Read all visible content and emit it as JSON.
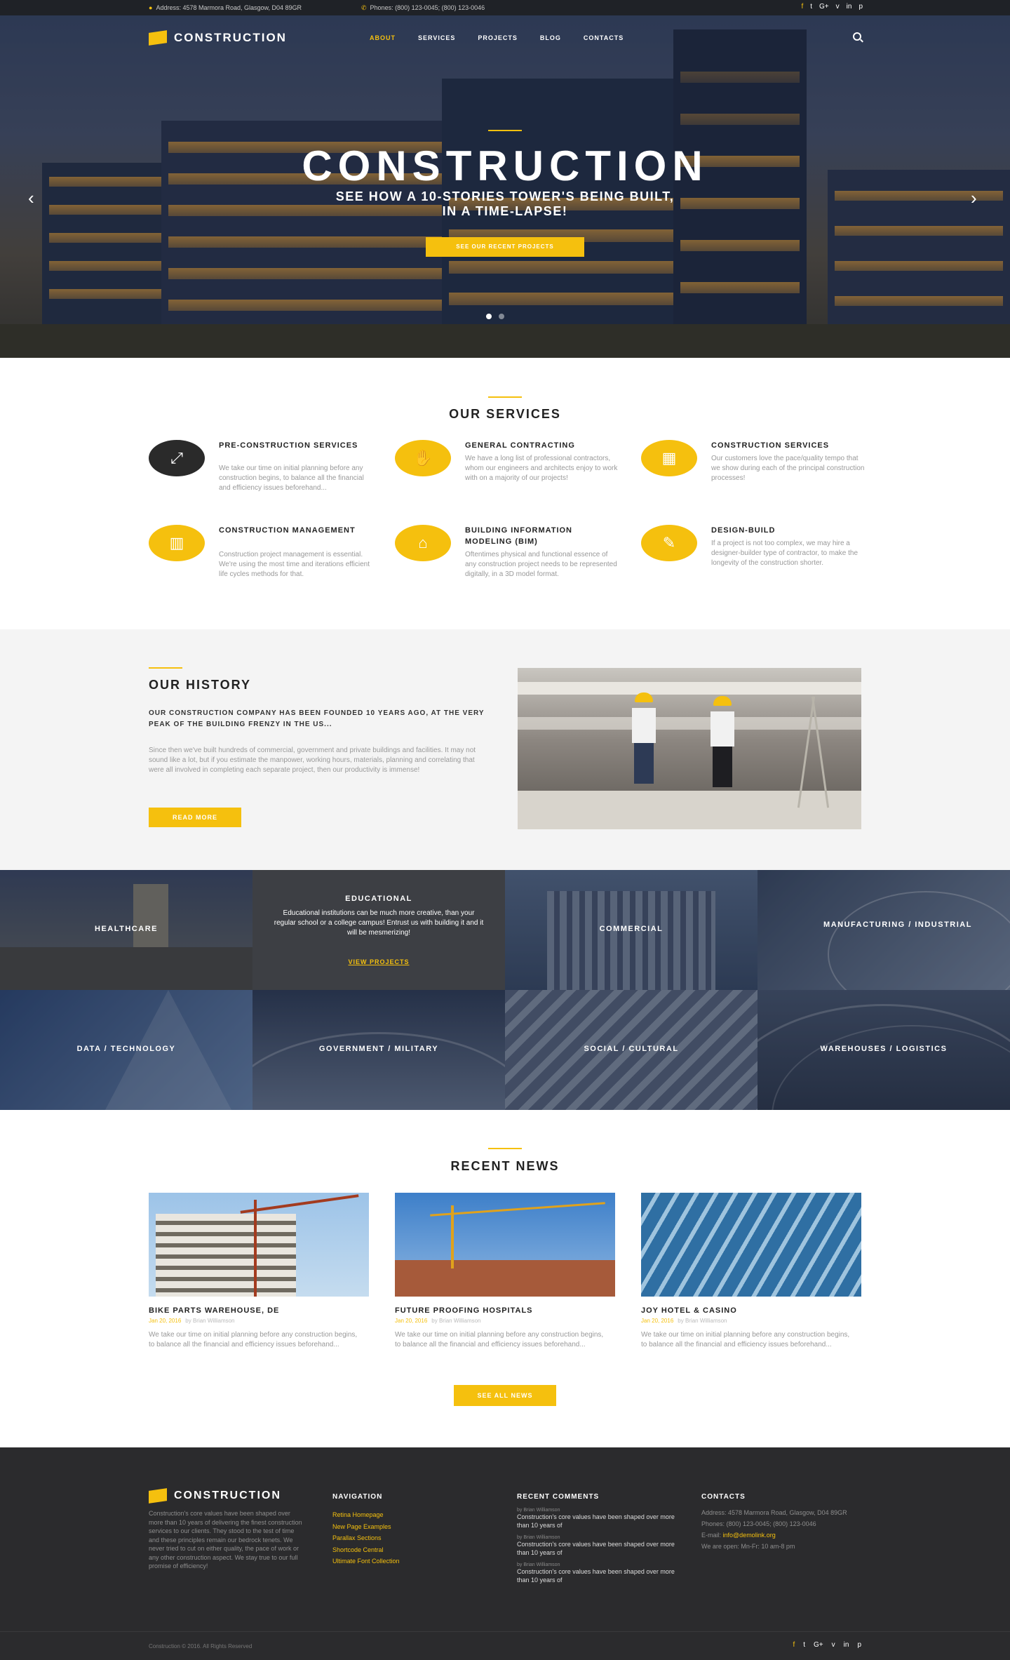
{
  "topbar": {
    "address": "Address: 4578 Marmora Road, Glasgow, D04 89GR",
    "phones": "Phones: (800) 123-0045; (800) 123-0046",
    "social": [
      "f",
      "t",
      "G+",
      "v",
      "in",
      "p"
    ]
  },
  "nav": {
    "brand": "CONSTRUCTION",
    "menu": [
      "ABOUT",
      "SERVICES",
      "PROJECTS",
      "BLOG",
      "CONTACTS"
    ]
  },
  "hero": {
    "title": "CONSTRUCTION",
    "subtitle_line1": "SEE HOW A 10-STORIES TOWER'S BEING BUILT,",
    "subtitle_line2": "IN A TIME-LAPSE!",
    "button": "SEE OUR RECENT PROJECTS"
  },
  "services": {
    "title": "OUR SERVICES",
    "items": [
      {
        "title": "PRE-CONSTRUCTION SERVICES",
        "desc": "We take our time on initial planning before any construction begins, to balance all the financial and efficiency issues beforehand...",
        "icon": "chart-icon"
      },
      {
        "title": "GENERAL CONTRACTING",
        "desc": "We have a long list of professional contractors, whom our engineers and architects enjoy to work with on a majority of our projects!",
        "icon": "handshake-icon"
      },
      {
        "title": "CONSTRUCTION SERVICES",
        "desc": "Our customers love the pace/quality tempo that we show during each of the principal construction processes!",
        "icon": "brick-icon"
      },
      {
        "title": "CONSTRUCTION MANAGEMENT",
        "desc": "Construction project management is essential. We're using the most time and iterations efficient life cycles methods for that.",
        "icon": "book-icon"
      },
      {
        "title": "BUILDING INFORMATION MODELING (BIM)",
        "desc": "Oftentimes physical and functional essence of any construction project needs to be represented digitally, in a 3D model format.",
        "icon": "home-icon"
      },
      {
        "title": "DESIGN-BUILD",
        "desc": "If a project is not too complex, we may hire a designer-builder type of contractor, to make the longevity of the construction shorter.",
        "icon": "pencil-icon"
      }
    ]
  },
  "history": {
    "title": "OUR HISTORY",
    "lead": "OUR CONSTRUCTION COMPANY HAS BEEN FOUNDED 10 YEARS AGO, AT THE VERY PEAK OF THE BUILDING FRENZY IN THE US...",
    "body": "Since then we've built hundreds of commercial, government and private buildings and facilities. It may not sound like a lot, but if you estimate the manpower, working hours, materials, planning and correlating that were all involved in completing each separate project, then our productivity is immense!",
    "button": "READ MORE"
  },
  "categories": [
    {
      "label": "HEALTHCARE"
    },
    {
      "label": "EDUCATIONAL",
      "text": "Educational institutions can be much more creative, than your regular school or a college campus! Entrust us with building it and it will be mesmerizing!",
      "link": "VIEW PROJECTS"
    },
    {
      "label": "COMMERCIAL"
    },
    {
      "label": "MANUFACTURING / INDUSTRIAL"
    },
    {
      "label": "DATA / TECHNOLOGY"
    },
    {
      "label": "GOVERNMENT / MILITARY"
    },
    {
      "label": "SOCIAL / CULTURAL"
    },
    {
      "label": "WAREHOUSES / LOGISTICS"
    }
  ],
  "news": {
    "title": "RECENT NEWS",
    "items": [
      {
        "title": "BIKE PARTS WAREHOUSE, DE",
        "date": "Jan 20, 2016",
        "author": "by Brian Williamson",
        "desc": "We take our time on initial planning before any construction begins, to balance all the financial and efficiency issues beforehand..."
      },
      {
        "title": "FUTURE PROOFING HOSPITALS",
        "date": "Jan 20, 2016",
        "author": "by Brian Williamson",
        "desc": "We take our time on initial planning before any construction begins, to balance all the financial and efficiency issues beforehand..."
      },
      {
        "title": "JOY HOTEL & CASINO",
        "date": "Jan 20, 2016",
        "author": "by Brian Williamson",
        "desc": "We take our time on initial planning before any construction begins, to balance all the financial and efficiency issues beforehand..."
      }
    ],
    "button": "SEE ALL NEWS"
  },
  "footer": {
    "brand": "CONSTRUCTION",
    "about": "Construction's core values have been shaped over more than 10 years of delivering the finest construction services to our clients. They stood to the test of time and these principles remain our bedrock tenets. We never tried to cut on either quality, the pace of work or any other construction aspect. We stay true to our full promise of efficiency!",
    "nav_title": "NAVIGATION",
    "nav_links": [
      "Retina Homepage",
      "New Page Examples",
      "Parallax Sections",
      "Shortcode Central",
      "Ultimate Font Collection"
    ],
    "comments_title": "RECENT COMMENTS",
    "comments": [
      {
        "by": "by Brian Williamson",
        "text": "Construction's core values have been shaped over more than 10 years of"
      },
      {
        "by": "by Brian Williamson",
        "text": "Construction's core values have been shaped over more than 10 years of"
      },
      {
        "by": "by Brian Williamson",
        "text": "Construction's core values have been shaped over more than 10 years of"
      }
    ],
    "contacts_title": "CONTACTS",
    "contact_address": "Address: 4578 Marmora Road, Glasgow, D04 89GR",
    "contact_phones": "Phones: (800) 123-0045; (800) 123-0046",
    "contact_email_label": "E-mail:",
    "contact_email": "info@demolink.org",
    "contact_hours": "We are open: Mn-Fr: 10 am-8 pm",
    "copyright": "Construction © 2016. All Rights Reserved",
    "social": [
      "f",
      "t",
      "G+",
      "v",
      "in",
      "p"
    ]
  }
}
